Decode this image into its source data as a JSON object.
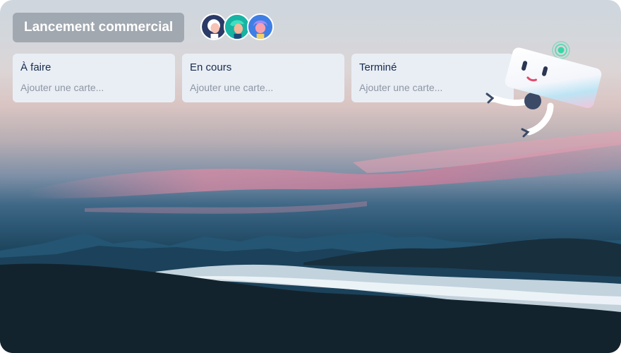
{
  "board": {
    "title": "Lancement commercial",
    "members": [
      {
        "name": "avatar-member-1",
        "bg": "#d5d8e0",
        "hair": "#ffffff",
        "skin": "#f6c3b5"
      },
      {
        "name": "avatar-member-2",
        "bg": "#17b3a3",
        "hair": "#3fe0c0",
        "skin": "#f4b89b"
      },
      {
        "name": "avatar-member-3",
        "bg": "#3f7fe5",
        "hair": "#a58bf0",
        "skin": "#f6a0b0"
      }
    ]
  },
  "lists": [
    {
      "title": "À faire",
      "add_card": "Ajouter une carte..."
    },
    {
      "title": "En cours",
      "add_card": "Ajouter une carte..."
    },
    {
      "title": "Terminé",
      "add_card": "Ajouter une carte..."
    }
  ],
  "colors": {
    "list_bg": "#e9eef5",
    "list_title": "#172b4d",
    "placeholder": "#8e96a3",
    "title_chip": "rgba(120,130,140,0.55)"
  },
  "mascot": {
    "icon": "robot-mascot-icon",
    "signal": "signal-icon"
  }
}
